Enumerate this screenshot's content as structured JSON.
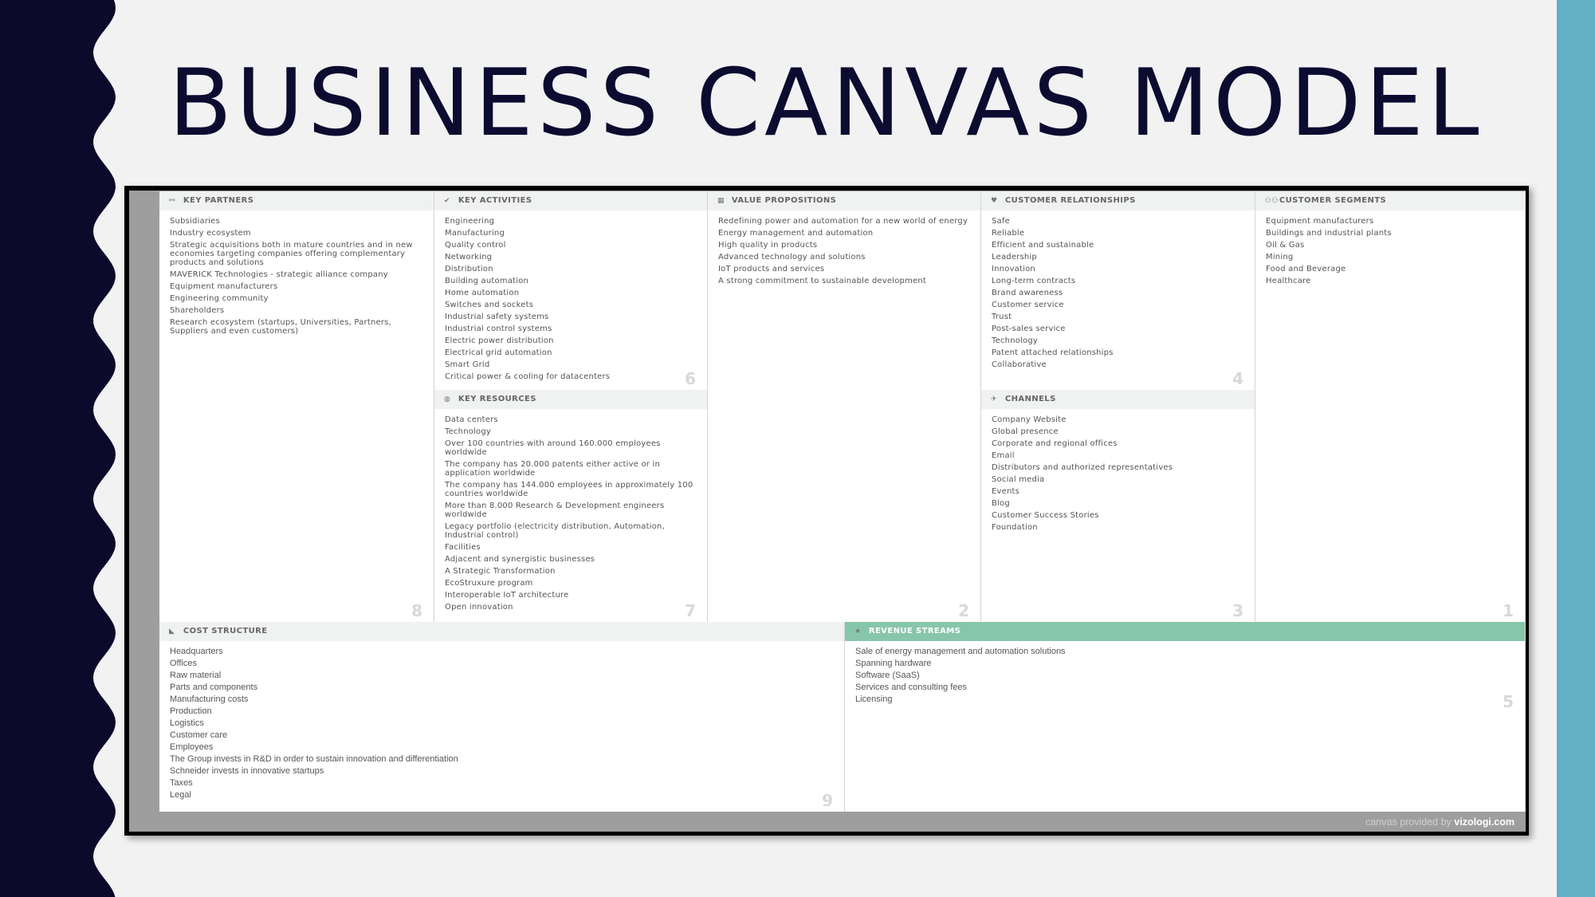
{
  "slide": {
    "title": "BUSINESS CANVAS MODEL",
    "colors": {
      "navy": "#0b0a2b",
      "teal": "#62b0c4",
      "revenue_header": "#88c6aa"
    }
  },
  "canvas": {
    "footer_prefix": "canvas provided by",
    "footer_brand": "vizologi.com",
    "blocks": [
      {
        "id": "key-partners",
        "title": "KEY PARTNERS",
        "icon": "link-icon",
        "glyph": "⚯",
        "number": "8",
        "items": [
          "Subsidiaries",
          "Industry ecosystem",
          "Strategic acquisitions both in mature countries and in new economies targeting companies offering complementary products and solutions",
          "MAVERICK Technologies - strategic alliance company",
          "Equipment manufacturers",
          "Engineering community",
          "Shareholders",
          "Research ecosystem (startups, Universities, Partners, Suppliers and even customers)"
        ]
      },
      {
        "id": "key-activities",
        "title": "KEY ACTIVITIES",
        "icon": "check-icon",
        "glyph": "✔",
        "number": "6",
        "items": [
          "Engineering",
          "Manufacturing",
          "Quality control",
          "Networking",
          "Distribution",
          "Building automation",
          "Home automation",
          "Switches and sockets",
          "Industrial safety systems",
          "Industrial control systems",
          "Electric power distribution",
          "Electrical grid automation",
          "Smart Grid",
          "Critical power & cooling for datacenters"
        ]
      },
      {
        "id": "key-resources",
        "title": "KEY RESOURCES",
        "icon": "resources-icon",
        "glyph": "◍",
        "number": "7",
        "items": [
          "Data centers",
          "Technology",
          "Over 100 countries with around 160.000 employees worldwide",
          "The company has 20.000 patents either active or in application worldwide",
          "The company has 144.000 employees in approximately 100 countries worldwide",
          "More than 8.000 Research & Development engineers worldwide",
          "Legacy portfolio (electricity distribution, Automation, Industrial control)",
          "Facilities",
          "Adjacent and synergistic businesses",
          "A Strategic Transformation",
          "EcoStruxure program",
          "Interoperable IoT architecture",
          "Open innovation"
        ]
      },
      {
        "id": "value-propositions",
        "title": "VALUE PROPOSITIONS",
        "icon": "gift-icon",
        "glyph": "▦",
        "number": "2",
        "items": [
          "Redefining power and automation for a new world of energy",
          "Energy management and automation",
          "High quality in products",
          "Advanced technology and solutions",
          "IoT products and services",
          "A strong commitment to sustainable development"
        ]
      },
      {
        "id": "customer-relationships",
        "title": "CUSTOMER RELATIONSHIPS",
        "icon": "heart-icon",
        "glyph": "♥",
        "number": "4",
        "items": [
          "Safe",
          "Reliable",
          "Efficient and sustainable",
          "Leadership",
          "Innovation",
          "Long-term contracts",
          "Brand awareness",
          "Customer service",
          "Trust",
          "Post-sales service",
          "Technology",
          "Patent attached relationships",
          "Collaborative"
        ]
      },
      {
        "id": "channels",
        "title": "CHANNELS",
        "icon": "plane-icon",
        "glyph": "✈",
        "number": "3",
        "items": [
          "Company Website",
          "Global presence",
          "Corporate and regional offices",
          "Email",
          "Distributors and authorized representatives",
          "Social media",
          "Events",
          "Blog",
          "Customer Success Stories",
          "Foundation"
        ]
      },
      {
        "id": "customer-segments",
        "title": "CUSTOMER SEGMENTS",
        "icon": "users-icon",
        "glyph": "⚇⚇",
        "number": "1",
        "items": [
          "Equipment manufacturers",
          "Buildings and industrial plants",
          "Oil & Gas",
          "Mining",
          "Food and Beverage",
          "Healthcare"
        ]
      },
      {
        "id": "cost-structure",
        "title": "COST STRUCTURE",
        "icon": "tag-icon",
        "glyph": "◣",
        "number": "9",
        "items": [
          "Headquarters",
          "Offices",
          "Raw material",
          "Parts and components",
          "Manufacturing costs",
          "Production",
          "Logistics",
          "Customer care",
          "Employees",
          "The Group invests in R&D in order to sustain innovation and differentiation",
          "Schneider invests in innovative startups",
          "Taxes",
          "Legal"
        ]
      },
      {
        "id": "revenue-streams",
        "title": "REVENUE STREAMS",
        "icon": "star-icon",
        "glyph": "★",
        "number": "5",
        "items": [
          "Sale of energy management and automation solutions",
          "Spanning hardware",
          "Software (SaaS)",
          "Services and consulting fees",
          "Licensing"
        ]
      }
    ]
  }
}
